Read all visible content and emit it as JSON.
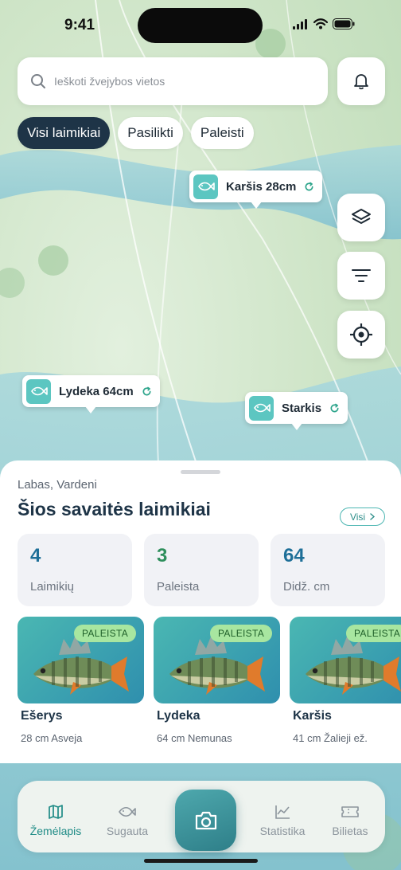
{
  "status": {
    "time": "9:41"
  },
  "search": {
    "placeholder": "Ieškoti žvejybos vietos"
  },
  "filters": [
    "Visi laimikiai",
    "Pasilikti",
    "Paleisti"
  ],
  "pins": [
    {
      "label": "Karšis 28cm",
      "icon": "fish-icon",
      "status_icon": "refresh-icon"
    },
    {
      "label": "Lydeka 64cm",
      "icon": "fish-icon",
      "status_icon": "refresh-icon"
    },
    {
      "label": "Starkis",
      "icon": "fish-icon",
      "status_icon": "refresh-icon"
    }
  ],
  "side_buttons": [
    "layers-icon",
    "filter-icon",
    "locate-icon"
  ],
  "sheet": {
    "greeting": "Labas, Vardeni",
    "title": "Šios savaitės laimikiai",
    "see_all": "Visi",
    "stats": [
      {
        "value": "4",
        "label": "Laimikių",
        "color": "#1e6f98"
      },
      {
        "value": "3",
        "label": "Paleista",
        "color": "#2e8f5c"
      },
      {
        "value": "64",
        "label": "Didž. cm",
        "color": "#1e6f98"
      }
    ],
    "catches": [
      {
        "badge": "PALEISTA",
        "name": "Ešerys",
        "details": "28 cm Asveja"
      },
      {
        "badge": "PALEISTA",
        "name": "Lydeka",
        "details": "64 cm Nemunas"
      },
      {
        "badge": "PALEISTA",
        "name": "Karšis",
        "details": "41 cm Žalieji ež."
      }
    ]
  },
  "nav": {
    "items": [
      {
        "label": "Žemėlapis",
        "icon": "map-icon",
        "active": true
      },
      {
        "label": "Sugauta",
        "icon": "fish-icon",
        "active": false
      },
      {
        "label": "Statistika",
        "icon": "chart-icon",
        "active": false
      },
      {
        "label": "Bilietas",
        "icon": "ticket-icon",
        "active": false
      }
    ],
    "center": "camera-icon"
  },
  "colors": {
    "accent": "#1e8b86",
    "dark": "#1e3447",
    "water": "#8fc9d4",
    "badge": "#a8e6a0"
  }
}
